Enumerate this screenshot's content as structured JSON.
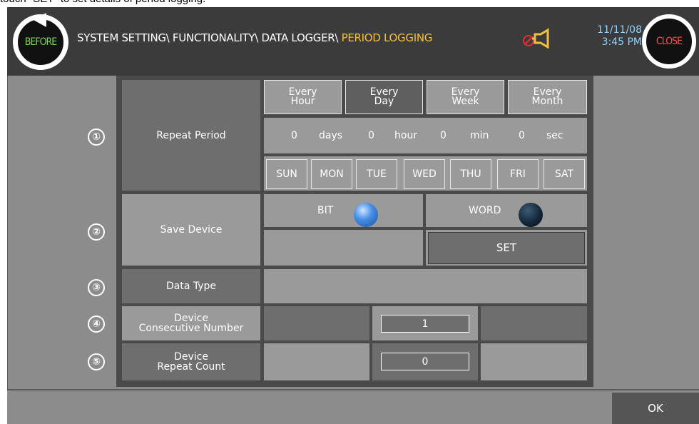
{
  "caption": "touch \"SET\" to set details of period logging.",
  "header": {
    "before_label": "BEFORE",
    "close_label": "CLOSE",
    "breadcrumb_path": "SYSTEM SETTING\\ FUNCTIONALITY\\ DATA LOGGER\\ ",
    "breadcrumb_current": "PERIOD LOGGING",
    "date": "11/11/08",
    "time": "3:45 PM"
  },
  "rows": {
    "repeat_period": {
      "number": "①",
      "label": "Repeat Period",
      "period_buttons": [
        "Every\nHour",
        "Every\nDay",
        "Every\nWeek",
        "Every\nMonth"
      ],
      "selected_period": "Every Day",
      "interval": {
        "days_value": "0",
        "days_unit": "days",
        "hour_value": "0",
        "hour_unit": "hour",
        "min_value": "0",
        "min_unit": "min",
        "sec_value": "0",
        "sec_unit": "sec"
      },
      "weekdays": [
        "SUN",
        "MON",
        "TUE",
        "WED",
        "THU",
        "FRI",
        "SAT"
      ]
    },
    "save_device": {
      "number": "②",
      "label": "Save Device",
      "bit_label": "BIT",
      "word_label": "WORD",
      "selected": "BIT",
      "set_label": "SET"
    },
    "data_type": {
      "number": "③",
      "label": "Data Type"
    },
    "consecutive": {
      "number": "④",
      "label": "Device\nConsecutive Number",
      "value": "1"
    },
    "repeat_count": {
      "number": "⑤",
      "label": "Device\nRepeat Count",
      "value": "0"
    }
  },
  "footer": {
    "ok_label": "OK"
  },
  "colors": {
    "accent_yellow": "#f0c040",
    "clock_blue": "#8fd3ff",
    "led_on": "#2f78d8",
    "led_off": "#0f2438",
    "alarm_red": "#e03030"
  }
}
